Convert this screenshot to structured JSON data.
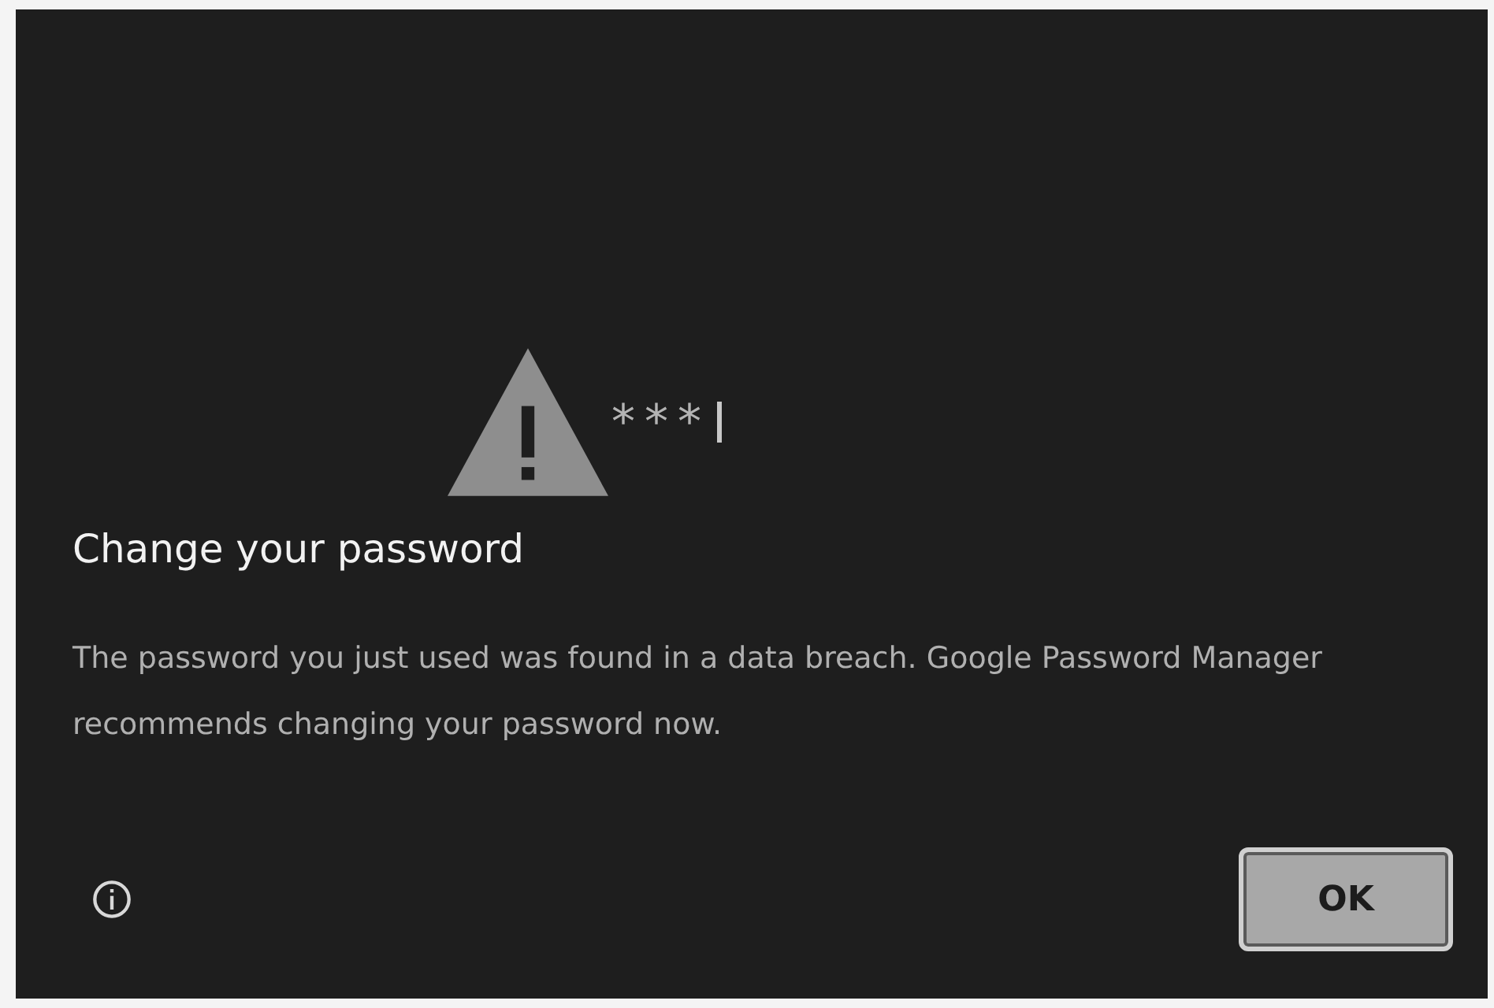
{
  "dialog": {
    "illustration": {
      "masked_text": "***"
    },
    "title": "Change your password",
    "message": "The password you just used was found in a data breach. Google Password Manager recommends changing your password now.",
    "buttons": [
      {
        "label": "OK",
        "kind": "primary"
      }
    ]
  }
}
